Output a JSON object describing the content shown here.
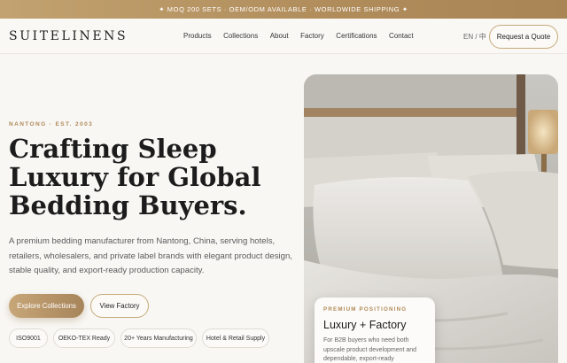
{
  "announcement": "✦ MOQ 200 SETS · OEM/ODM AVAILABLE · WORLDWIDE SHIPPING ✦",
  "brand": "SUITELINENS",
  "nav": {
    "items": [
      "Products",
      "Collections",
      "About",
      "Factory",
      "Certifications",
      "Contact"
    ],
    "lang": "EN / 中",
    "cta": "Request a Quote"
  },
  "hero": {
    "eyebrow": "NANTONG · EST. 2003",
    "headline": "Crafting Sleep Luxury for Global Bedding Buyers.",
    "lede": "A premium bedding manufacturer from Nantong, China, serving hotels, retailers, wholesalers, and private label brands with elegant product design, stable quality, and export-ready production capacity.",
    "primary_cta": "Explore Collections",
    "secondary_cta": "View Factory",
    "badges": [
      "ISO9001",
      "OEKO-TEX Ready",
      "20+ Years Manufacturing",
      "Hotel & Retail Supply"
    ]
  },
  "card": {
    "eyebrow": "PREMIUM POSITIONING",
    "title": "Luxury + Factory",
    "body": "For B2B buyers who need both upscale product development and dependable, export-ready"
  },
  "colors": {
    "accent": "#b08a58",
    "topbar": "#b99764",
    "background": "#f8f7f4"
  }
}
